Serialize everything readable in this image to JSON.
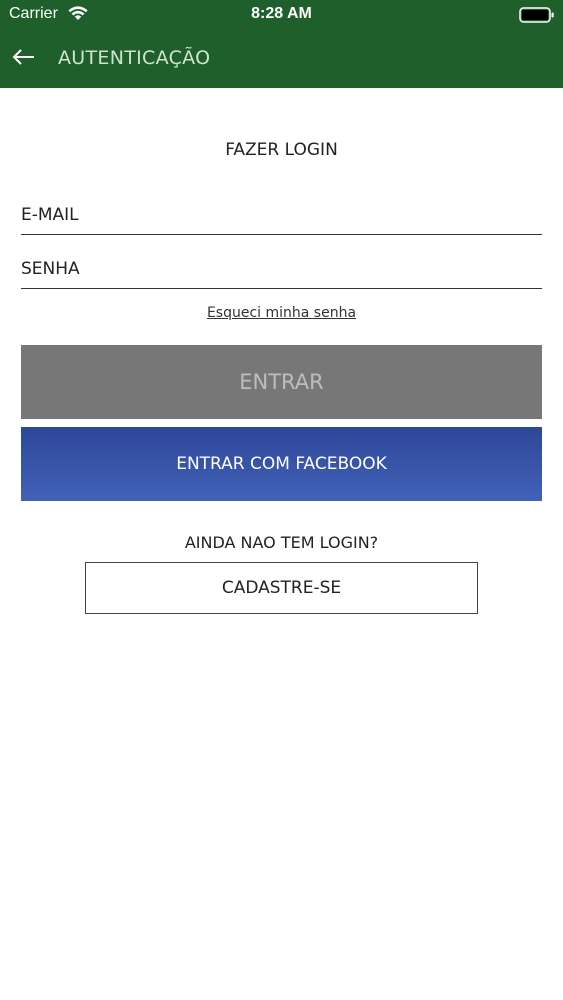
{
  "status_bar": {
    "carrier": "Carrier",
    "time": "8:28 AM",
    "wifi_icon": "wifi-icon",
    "battery_icon": "battery-icon"
  },
  "header": {
    "title": "AUTENTICAÇÃO",
    "back_icon": "arrow-left-icon",
    "color": "#1f5f2b",
    "title_color": "#cfe3cf"
  },
  "login": {
    "heading": "FAZER LOGIN",
    "email_placeholder": "E-MAIL",
    "email_value": "",
    "password_placeholder": "SENHA",
    "password_value": "",
    "forgot_label": "Esqueci minha senha",
    "submit_label": "ENTRAR",
    "submit_color": "#777777",
    "facebook_label": "ENTRAR COM FACEBOOK",
    "facebook_color": "#3a58ac"
  },
  "signup": {
    "prompt": "AINDA NAO TEM LOGIN?",
    "button_label": "CADASTRE-SE"
  }
}
